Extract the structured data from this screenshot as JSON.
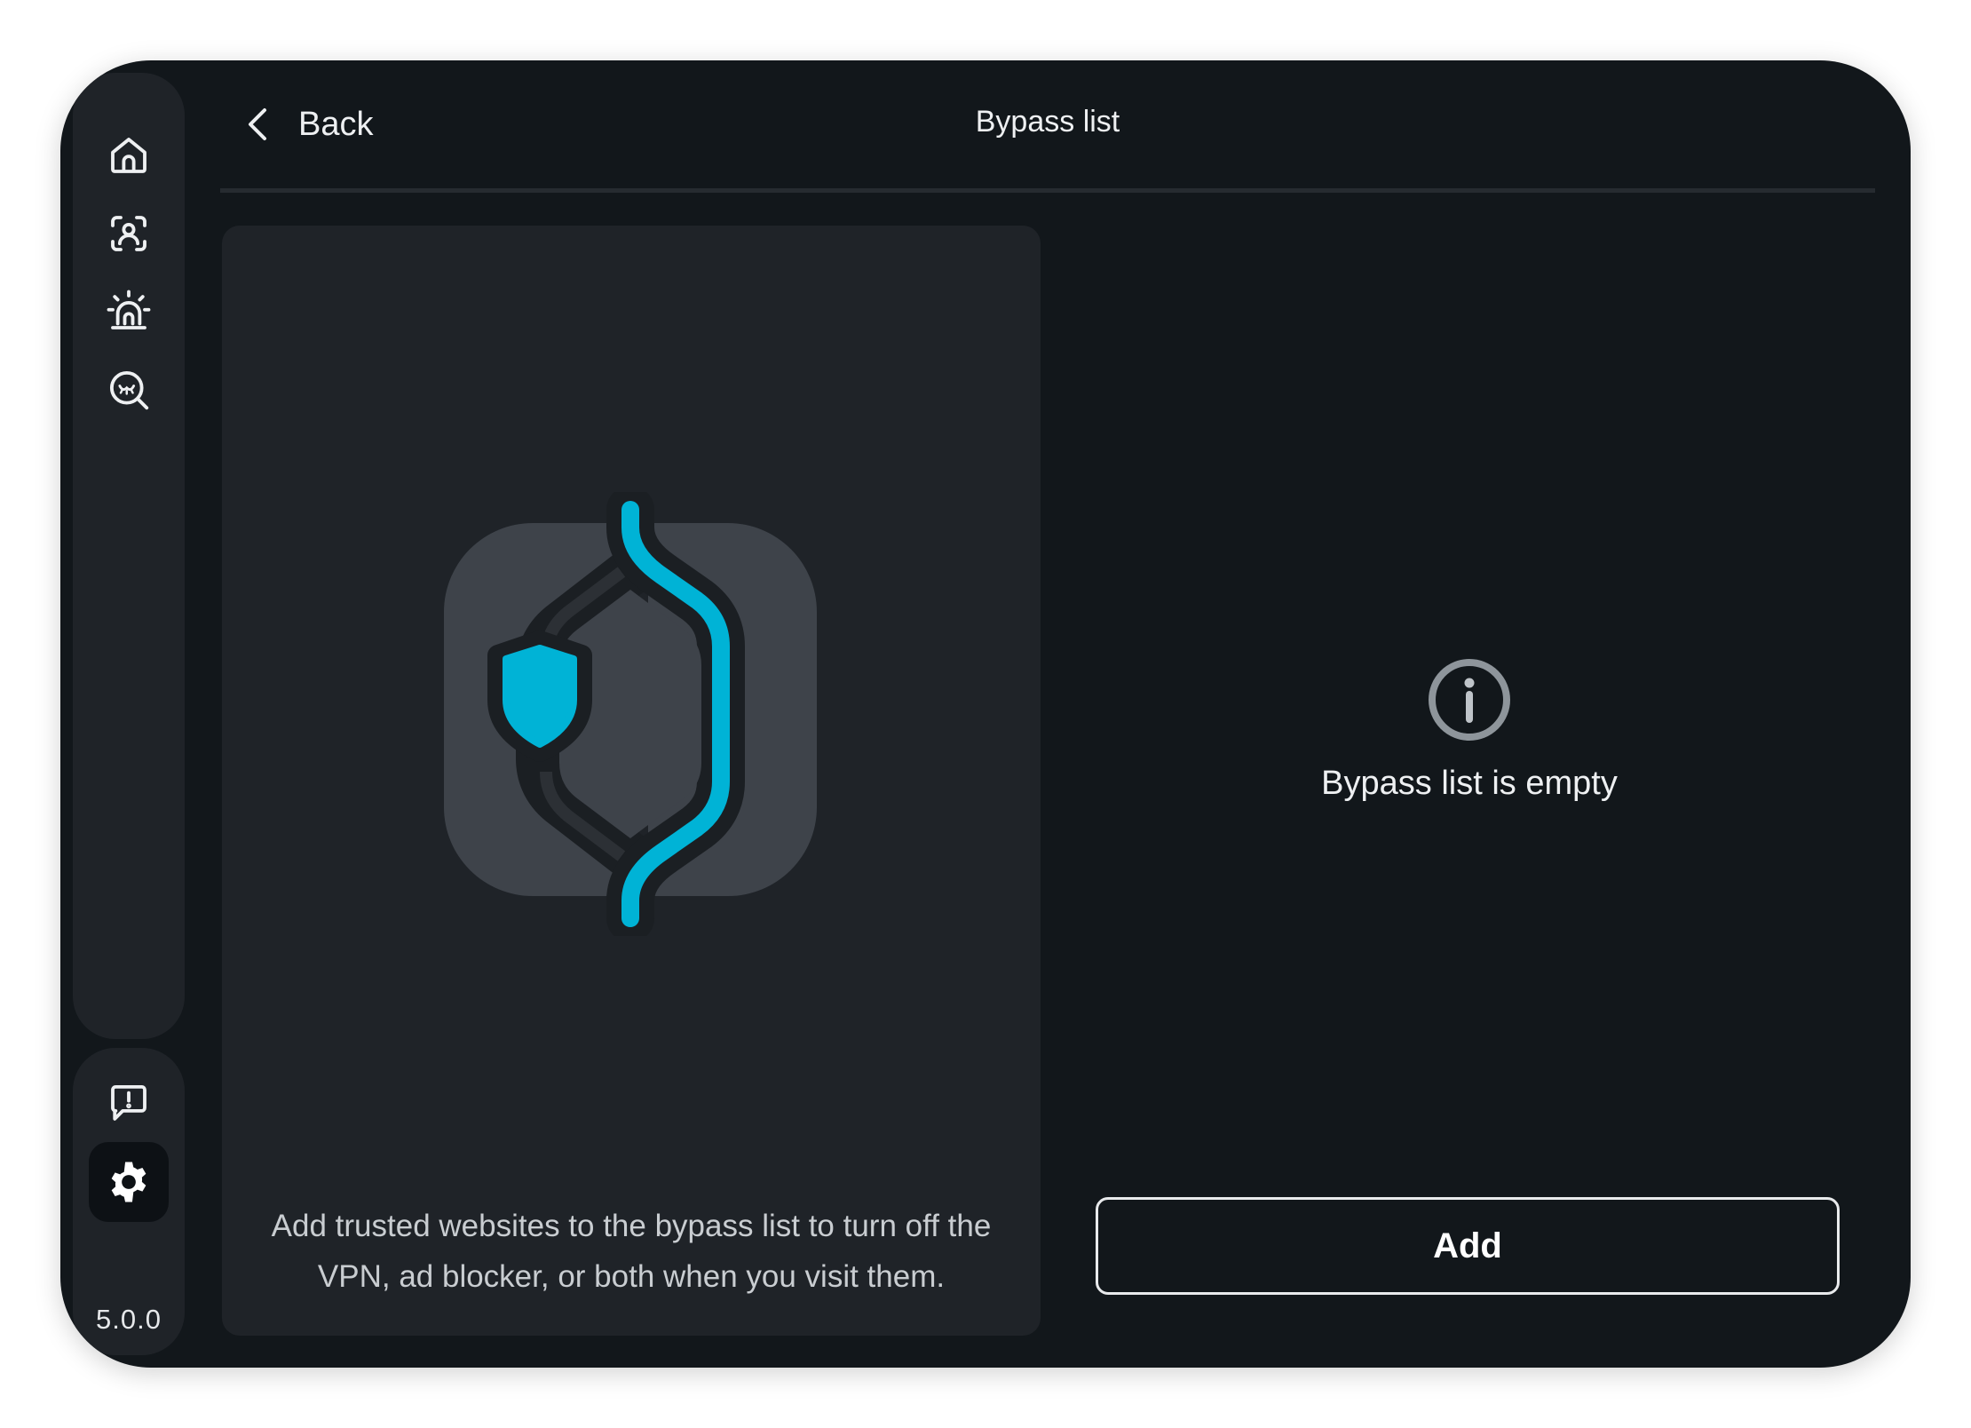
{
  "sidebar": {
    "items": [
      {
        "id": "home",
        "icon": "home-icon"
      },
      {
        "id": "account",
        "icon": "user-scan-icon"
      },
      {
        "id": "alerts",
        "icon": "alarm-icon"
      },
      {
        "id": "search",
        "icon": "search-icon"
      }
    ],
    "bottom_items": [
      {
        "id": "feedback",
        "icon": "feedback-icon"
      },
      {
        "id": "settings",
        "icon": "gear-icon",
        "active": true
      }
    ],
    "version": "5.0.0"
  },
  "header": {
    "back_label": "Back",
    "title": "Bypass list"
  },
  "info_card": {
    "description": "Add trusted websites to the bypass list to turn off the VPN, ad blocker, or both when you visit them."
  },
  "empty_state": {
    "message": "Bypass list is empty"
  },
  "actions": {
    "add_label": "Add"
  },
  "colors": {
    "background": "#12171b",
    "panel": "#1f2328",
    "accent": "#00b3d6",
    "icon_gray": "#bfc4c9"
  }
}
